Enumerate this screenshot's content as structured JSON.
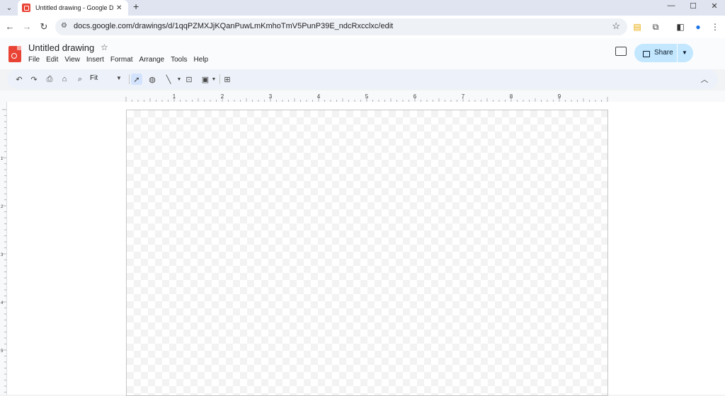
{
  "browser": {
    "tab_title": "Untitled drawing - Google Drawings",
    "new_tab_label": "+",
    "url": "docs.google.com/drawings/d/1qqPZMXJjKQanPuwLmKmhoTmV5PunP39E_ndcRxcclxc/edit"
  },
  "app": {
    "doc_title": "Untitled drawing",
    "menu": [
      "File",
      "Edit",
      "View",
      "Insert",
      "Format",
      "Arrange",
      "Tools",
      "Help"
    ],
    "share_label": "Share"
  },
  "toolbar": {
    "zoom_value": "Fit"
  },
  "ruler": {
    "h_numbers": [
      "1",
      "2",
      "3",
      "4",
      "5",
      "6",
      "7",
      "8",
      "9"
    ],
    "v_numbers": [
      "1",
      "2",
      "3",
      "4",
      "5"
    ]
  },
  "colors": {
    "accent": "#c2e7ff",
    "brand": "#e94335",
    "toolbar_bg": "#edf2fa"
  },
  "icons": {
    "tab": [
      "tab-search-icon",
      "drawings-favicon-icon",
      "close-icon",
      "new-tab-icon"
    ],
    "window": [
      "minimize-icon",
      "maximize-icon",
      "close-window-icon"
    ],
    "nav": [
      "back-icon",
      "forward-icon",
      "reload-icon",
      "site-info-icon",
      "bookmark-star-icon"
    ],
    "toolbar": [
      "undo-icon",
      "redo-icon",
      "print-icon",
      "paint-format-icon",
      "zoom-icon",
      "select-icon",
      "shape-icon",
      "line-icon",
      "textbox-icon",
      "image-icon",
      "comment-add-icon",
      "collapse-icon"
    ]
  }
}
